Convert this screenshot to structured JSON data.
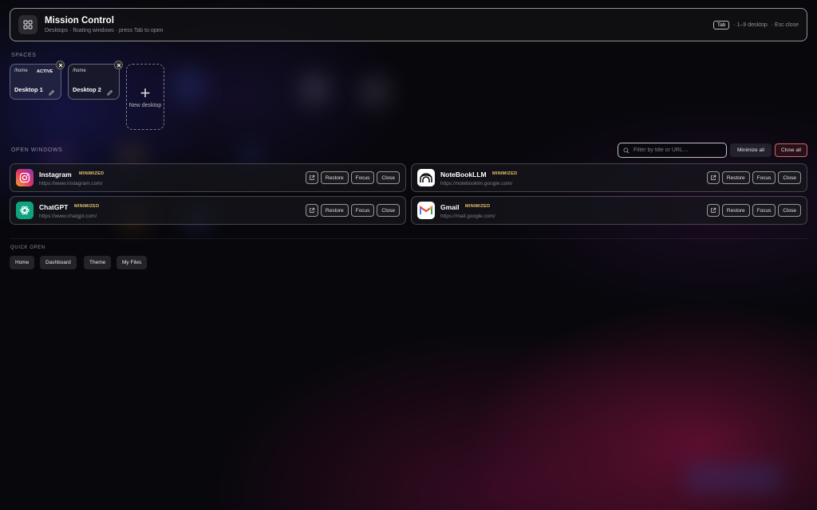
{
  "header": {
    "title": "Mission Control",
    "subtitle": "Desktops · floating windows · press Tab to open",
    "kbd": "Tab",
    "hint_desktop": "· 1–9 desktop",
    "hint_close": "· Esc close"
  },
  "spaces": {
    "label": "SPACES",
    "items": [
      {
        "path": "/home",
        "active_label": "ACTIVE",
        "name": "Desktop 1",
        "active": true
      },
      {
        "path": "/home",
        "name": "Desktop 2",
        "active": false
      }
    ],
    "new_label": "New desktop"
  },
  "open_windows": {
    "label": "OPEN WINDOWS",
    "filter_placeholder": "Filter by title or URL…",
    "minimize_all": "Minimize all",
    "close_all": "Close all",
    "restore_label": "Restore",
    "focus_label": "Focus",
    "close_label": "Close",
    "windows": [
      {
        "name": "Instagram",
        "status": "MINIMIZED",
        "url": "https://www.instagram.com/",
        "icon": "instagram-icon"
      },
      {
        "name": "NoteBookLLM",
        "status": "MINIMIZED",
        "url": "https://notebooklm.google.com/",
        "icon": "notebooklm-icon"
      },
      {
        "name": "ChatGPT",
        "status": "MINIMIZED",
        "url": "https://www.chatgpt.com/",
        "icon": "chatgpt-icon"
      },
      {
        "name": "Gmail",
        "status": "MINIMIZED",
        "url": "https://mail.google.com/",
        "icon": "gmail-icon"
      }
    ]
  },
  "quick_open": {
    "label": "QUICK OPEN",
    "items": [
      "Home",
      "Dashboard",
      "Theme",
      "My Files"
    ]
  },
  "colors": {
    "badge": "#e8c46a",
    "close_all_border": "#eb8282",
    "accent_bg": "#96144a"
  }
}
